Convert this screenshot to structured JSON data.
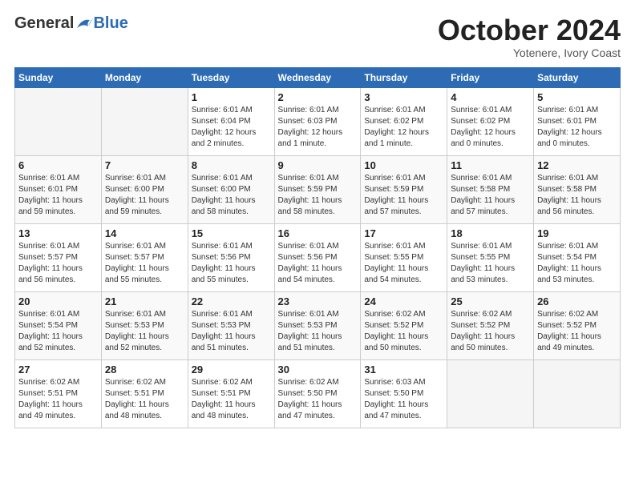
{
  "header": {
    "logo_general": "General",
    "logo_blue": "Blue",
    "month_title": "October 2024",
    "subtitle": "Yotenere, Ivory Coast"
  },
  "days_of_week": [
    "Sunday",
    "Monday",
    "Tuesday",
    "Wednesday",
    "Thursday",
    "Friday",
    "Saturday"
  ],
  "weeks": [
    [
      {
        "day": "",
        "info": ""
      },
      {
        "day": "",
        "info": ""
      },
      {
        "day": "1",
        "info": "Sunrise: 6:01 AM\nSunset: 6:04 PM\nDaylight: 12 hours\nand 2 minutes."
      },
      {
        "day": "2",
        "info": "Sunrise: 6:01 AM\nSunset: 6:03 PM\nDaylight: 12 hours\nand 1 minute."
      },
      {
        "day": "3",
        "info": "Sunrise: 6:01 AM\nSunset: 6:02 PM\nDaylight: 12 hours\nand 1 minute."
      },
      {
        "day": "4",
        "info": "Sunrise: 6:01 AM\nSunset: 6:02 PM\nDaylight: 12 hours\nand 0 minutes."
      },
      {
        "day": "5",
        "info": "Sunrise: 6:01 AM\nSunset: 6:01 PM\nDaylight: 12 hours\nand 0 minutes."
      }
    ],
    [
      {
        "day": "6",
        "info": "Sunrise: 6:01 AM\nSunset: 6:01 PM\nDaylight: 11 hours\nand 59 minutes."
      },
      {
        "day": "7",
        "info": "Sunrise: 6:01 AM\nSunset: 6:00 PM\nDaylight: 11 hours\nand 59 minutes."
      },
      {
        "day": "8",
        "info": "Sunrise: 6:01 AM\nSunset: 6:00 PM\nDaylight: 11 hours\nand 58 minutes."
      },
      {
        "day": "9",
        "info": "Sunrise: 6:01 AM\nSunset: 5:59 PM\nDaylight: 11 hours\nand 58 minutes."
      },
      {
        "day": "10",
        "info": "Sunrise: 6:01 AM\nSunset: 5:59 PM\nDaylight: 11 hours\nand 57 minutes."
      },
      {
        "day": "11",
        "info": "Sunrise: 6:01 AM\nSunset: 5:58 PM\nDaylight: 11 hours\nand 57 minutes."
      },
      {
        "day": "12",
        "info": "Sunrise: 6:01 AM\nSunset: 5:58 PM\nDaylight: 11 hours\nand 56 minutes."
      }
    ],
    [
      {
        "day": "13",
        "info": "Sunrise: 6:01 AM\nSunset: 5:57 PM\nDaylight: 11 hours\nand 56 minutes."
      },
      {
        "day": "14",
        "info": "Sunrise: 6:01 AM\nSunset: 5:57 PM\nDaylight: 11 hours\nand 55 minutes."
      },
      {
        "day": "15",
        "info": "Sunrise: 6:01 AM\nSunset: 5:56 PM\nDaylight: 11 hours\nand 55 minutes."
      },
      {
        "day": "16",
        "info": "Sunrise: 6:01 AM\nSunset: 5:56 PM\nDaylight: 11 hours\nand 54 minutes."
      },
      {
        "day": "17",
        "info": "Sunrise: 6:01 AM\nSunset: 5:55 PM\nDaylight: 11 hours\nand 54 minutes."
      },
      {
        "day": "18",
        "info": "Sunrise: 6:01 AM\nSunset: 5:55 PM\nDaylight: 11 hours\nand 53 minutes."
      },
      {
        "day": "19",
        "info": "Sunrise: 6:01 AM\nSunset: 5:54 PM\nDaylight: 11 hours\nand 53 minutes."
      }
    ],
    [
      {
        "day": "20",
        "info": "Sunrise: 6:01 AM\nSunset: 5:54 PM\nDaylight: 11 hours\nand 52 minutes."
      },
      {
        "day": "21",
        "info": "Sunrise: 6:01 AM\nSunset: 5:53 PM\nDaylight: 11 hours\nand 52 minutes."
      },
      {
        "day": "22",
        "info": "Sunrise: 6:01 AM\nSunset: 5:53 PM\nDaylight: 11 hours\nand 51 minutes."
      },
      {
        "day": "23",
        "info": "Sunrise: 6:01 AM\nSunset: 5:53 PM\nDaylight: 11 hours\nand 51 minutes."
      },
      {
        "day": "24",
        "info": "Sunrise: 6:02 AM\nSunset: 5:52 PM\nDaylight: 11 hours\nand 50 minutes."
      },
      {
        "day": "25",
        "info": "Sunrise: 6:02 AM\nSunset: 5:52 PM\nDaylight: 11 hours\nand 50 minutes."
      },
      {
        "day": "26",
        "info": "Sunrise: 6:02 AM\nSunset: 5:52 PM\nDaylight: 11 hours\nand 49 minutes."
      }
    ],
    [
      {
        "day": "27",
        "info": "Sunrise: 6:02 AM\nSunset: 5:51 PM\nDaylight: 11 hours\nand 49 minutes."
      },
      {
        "day": "28",
        "info": "Sunrise: 6:02 AM\nSunset: 5:51 PM\nDaylight: 11 hours\nand 48 minutes."
      },
      {
        "day": "29",
        "info": "Sunrise: 6:02 AM\nSunset: 5:51 PM\nDaylight: 11 hours\nand 48 minutes."
      },
      {
        "day": "30",
        "info": "Sunrise: 6:02 AM\nSunset: 5:50 PM\nDaylight: 11 hours\nand 47 minutes."
      },
      {
        "day": "31",
        "info": "Sunrise: 6:03 AM\nSunset: 5:50 PM\nDaylight: 11 hours\nand 47 minutes."
      },
      {
        "day": "",
        "info": ""
      },
      {
        "day": "",
        "info": ""
      }
    ]
  ]
}
